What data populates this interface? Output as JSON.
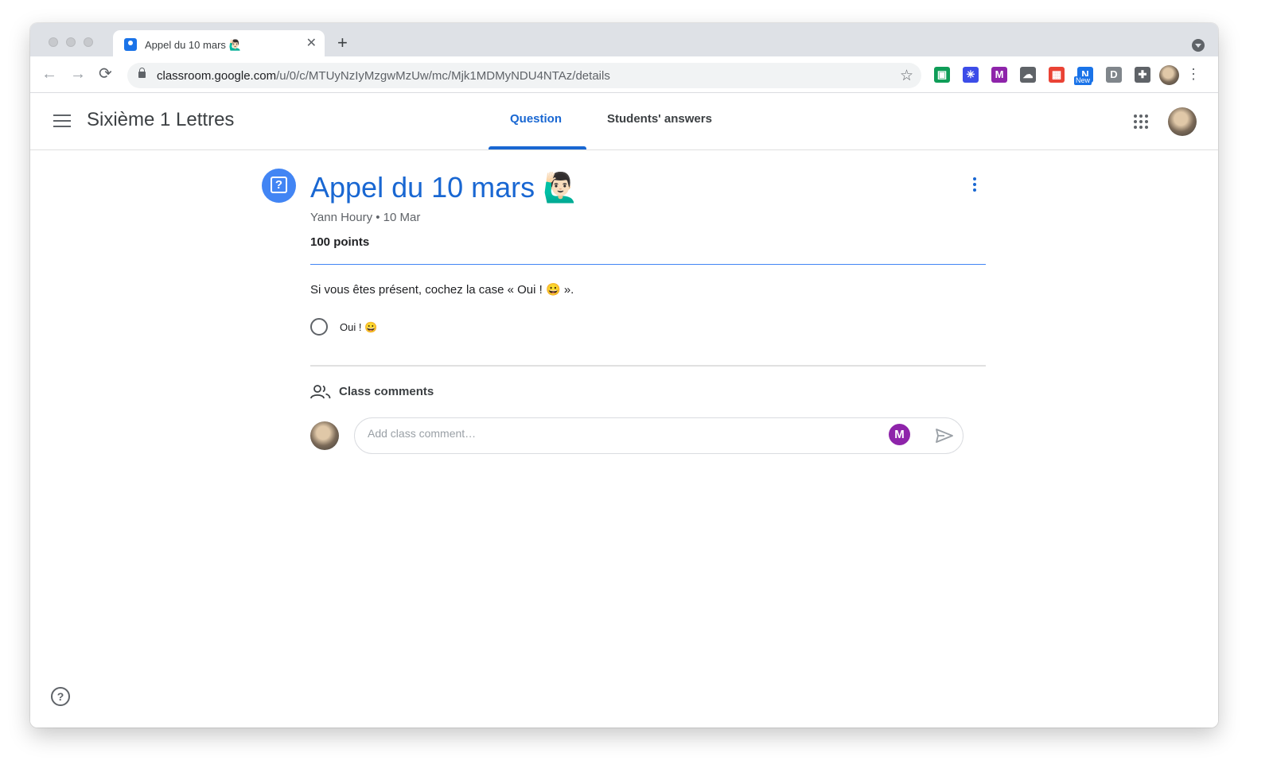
{
  "browser": {
    "tab_title": "Appel du 10 mars 🙋🏻‍♂️",
    "tab_close": "✕",
    "new_tab": "+",
    "url_host": "classroom.google.com",
    "url_path": "/u/0/c/MTUyNzIyMzgwMzUw/mc/Mjk1MDMyNDU4NTAz/details",
    "back": "←",
    "forward": "→",
    "reload": "⟳",
    "bookmark": "☆",
    "menu": "⋮",
    "extensions": [
      {
        "name": "classroom-ext-icon",
        "color": "#0f9d58",
        "glyph": "▣"
      },
      {
        "name": "asterisk-ext-icon",
        "color": "#3c4de8",
        "glyph": "✳"
      },
      {
        "name": "mote-ext-icon",
        "color": "#8e24aa",
        "glyph": "M"
      },
      {
        "name": "cloud-ext-icon",
        "color": "#5f6368",
        "glyph": "☁"
      },
      {
        "name": "calendar-ext-icon",
        "color": "#ea4335",
        "glyph": "▦"
      },
      {
        "name": "new-ext-icon",
        "color": "#1a73e8",
        "glyph": "N",
        "badge": "New"
      },
      {
        "name": "d-ext-icon",
        "color": "#80868b",
        "glyph": "D"
      },
      {
        "name": "puzzle-ext-icon",
        "color": "#5f6368",
        "glyph": "✚"
      }
    ]
  },
  "appbar": {
    "class_name": "Sixième 1 Lettres",
    "tabs": [
      {
        "label": "Question",
        "active": true
      },
      {
        "label": "Students' answers",
        "active": false
      }
    ]
  },
  "question": {
    "title": "Appel du 10 mars 🙋🏻‍♂️",
    "meta": "Yann Houry • 10 Mar",
    "points": "100 points",
    "text": "Si vous êtes présent, cochez la case « Oui ! 😀 ».",
    "options": [
      {
        "label": "Oui ! 😀",
        "selected": false
      }
    ]
  },
  "comments": {
    "heading": "Class comments",
    "placeholder": "Add class comment…"
  },
  "help": "?"
}
